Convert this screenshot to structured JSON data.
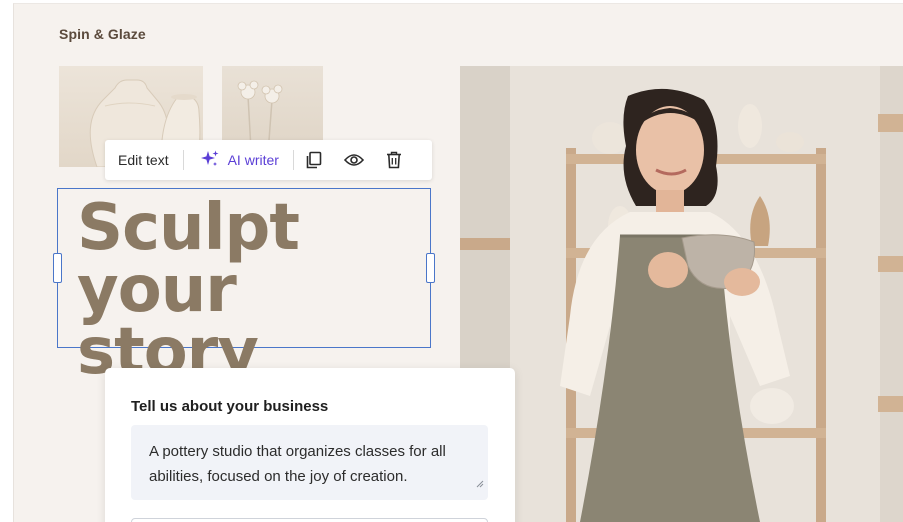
{
  "site": {
    "brand": "Spin & Glaze"
  },
  "toolbar": {
    "edit_text": "Edit text",
    "ai_writer": "AI writer",
    "icons": [
      "sparkles-icon",
      "duplicate-icon",
      "eye-icon",
      "trash-icon"
    ]
  },
  "headline": {
    "text": "Sculpt\nyour story",
    "color": "#8b7a64"
  },
  "form": {
    "label": "Tell us about your business",
    "value": "A pottery studio that organizes classes for all abilities, focused on the joy of creation."
  },
  "colors": {
    "canvas": "#f6f2ee",
    "brand_text": "#5b4a3c",
    "selection": "#4a76c9",
    "ai_accent": "#5b3fd6",
    "textarea_bg": "#f1f3f8"
  }
}
